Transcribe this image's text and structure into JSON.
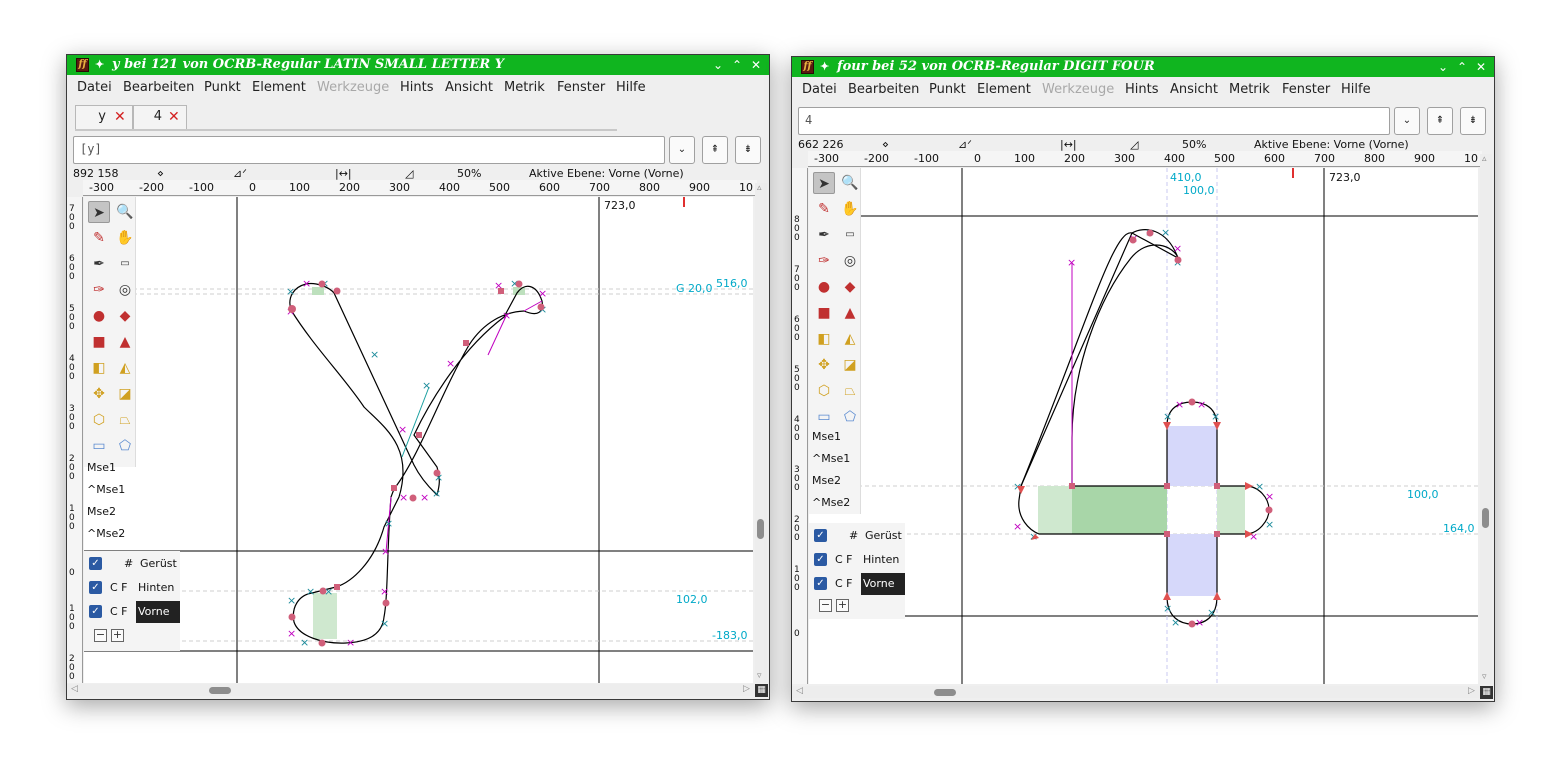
{
  "colors": {
    "titlebar": "#10b51f",
    "accent": "#00a9c8",
    "curve": "#000000",
    "control": "#c000c0",
    "point": "#d05060",
    "hint_green": "#a8d8a8",
    "hint_blue": "#d0d4f8"
  },
  "windows": [
    {
      "title": "y bei 121 von OCRB-Regular LATIN SMALL LETTER Y",
      "menu": [
        "Datei",
        "Bearbeiten",
        "Punkt",
        "Element",
        "Werkzeuge",
        "Hints",
        "Ansicht",
        "Metrik",
        "Fenster",
        "Hilfe"
      ],
      "tabs": [
        {
          "label": "y"
        },
        {
          "label": "4"
        }
      ],
      "input_value": "[y]",
      "info": {
        "coords": "892 158",
        "zoom": "50%",
        "layer": "Aktive Ebene: Vorne (Vorne)"
      },
      "ruler": [
        "-300",
        "-200",
        "-100",
        "0",
        "100",
        "200",
        "300",
        "400",
        "500",
        "600",
        "700",
        "800",
        "900",
        "10"
      ],
      "vruler": [
        "7\n0\n0",
        "6\n0\n0",
        "5\n0\n0",
        "4\n0\n0",
        "3\n0\n0",
        "2\n0\n0",
        "1\n0\n0",
        "0",
        "1\n0\n0",
        "2\n0\n0"
      ],
      "labels": {
        "width": "723,0",
        "g": "G 20,0",
        "top": "516,0",
        "baseline_a": "102,0",
        "descender": "-183,0"
      },
      "mouse": [
        "Mse1",
        "^Mse1",
        "Mse2",
        "^Mse2"
      ],
      "layers": [
        {
          "prefix": "#",
          "name": "Gerüst"
        },
        {
          "prefix": "C F",
          "name": "Hinten"
        },
        {
          "prefix": "C F",
          "name": "Vorne"
        }
      ]
    },
    {
      "title": "four bei 52 von OCRB-Regular DIGIT FOUR",
      "menu": [
        "Datei",
        "Bearbeiten",
        "Punkt",
        "Element",
        "Werkzeuge",
        "Hints",
        "Ansicht",
        "Metrik",
        "Fenster",
        "Hilfe"
      ],
      "input_value": "4",
      "info": {
        "coords": "662 226",
        "zoom": "50%",
        "layer": "Aktive Ebene: Vorne (Vorne)"
      },
      "ruler": [
        "-300",
        "-200",
        "-100",
        "0",
        "100",
        "200",
        "300",
        "400",
        "500",
        "600",
        "700",
        "800",
        "900",
        "10"
      ],
      "vruler": [
        "8\n0\n0",
        "7\n0\n0",
        "6\n0\n0",
        "5\n0\n0",
        "4\n0\n0",
        "3\n0\n0",
        "2\n0\n0",
        "1\n0\n0",
        "0"
      ],
      "labels": {
        "width": "723,0",
        "stem_x": "410,0",
        "stem_w": "100,0",
        "bar_h": "100,0",
        "bar_y": "164,0"
      },
      "mouse": [
        "Mse1",
        "^Mse1",
        "Mse2",
        "^Mse2"
      ],
      "layers": [
        {
          "prefix": "#",
          "name": "Gerüst"
        },
        {
          "prefix": "C F",
          "name": "Hinten"
        },
        {
          "prefix": "C F",
          "name": "Vorne"
        }
      ]
    }
  ]
}
